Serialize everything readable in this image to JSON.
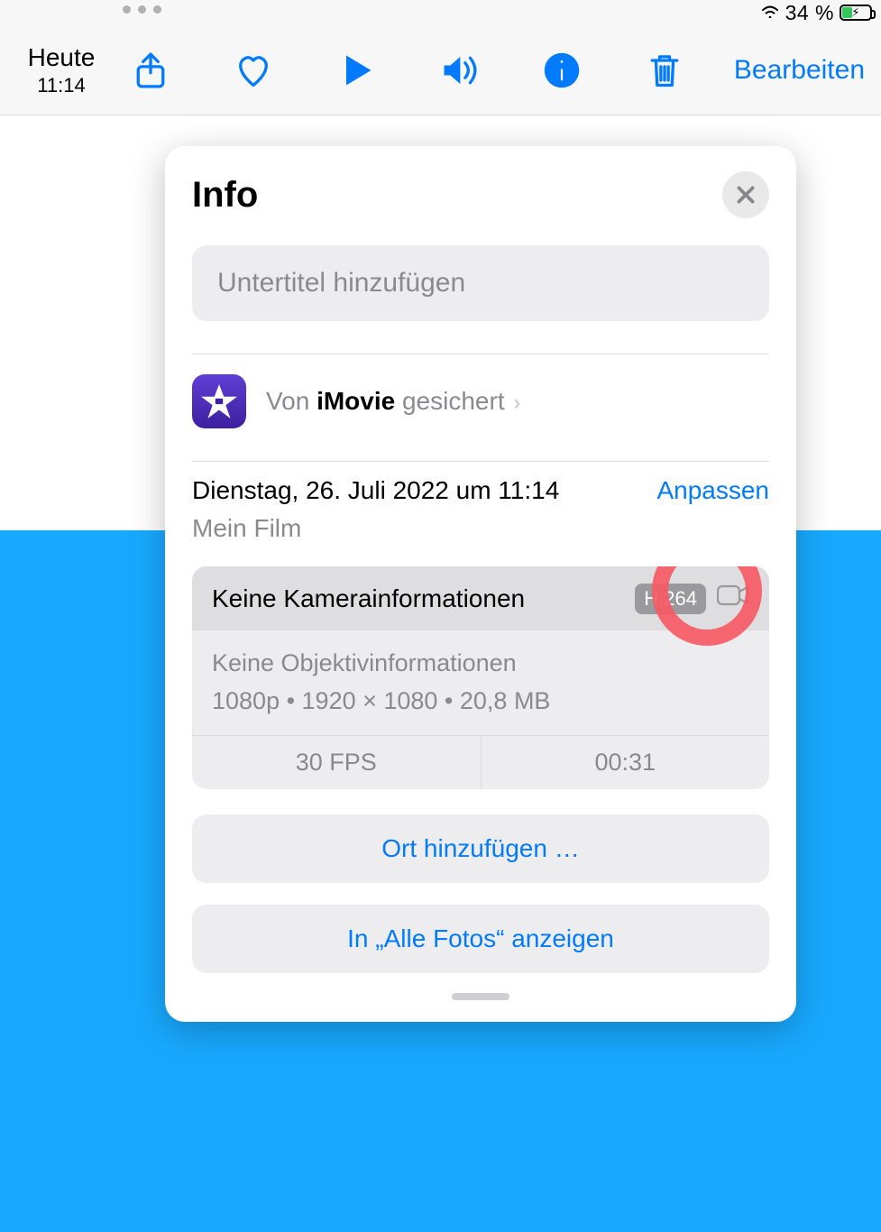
{
  "status": {
    "battery_pct": "34 %"
  },
  "toolbar": {
    "date_label": "Heute",
    "time_label": "11:14",
    "edit_label": "Bearbeiten"
  },
  "panel": {
    "title": "Info",
    "caption_placeholder": "Untertitel hinzufügen",
    "source_prefix": "Von ",
    "source_app": "iMovie",
    "source_suffix": " gesichert",
    "date_line": "Dienstag, 26. Juli 2022 um 11:14",
    "file_name": "Mein Film",
    "adjust_label": "Anpassen",
    "camera_info": "Keine Kamerainformationen",
    "codec": "H.264",
    "lens_info": "Keine Objektivinformationen",
    "spec_line": "1080p  •  1920 × 1080  •  20,8 MB",
    "fps": "30 FPS",
    "duration": "00:31",
    "add_location": "Ort hinzufügen …",
    "show_all": "In „Alle Fotos“ anzeigen"
  }
}
